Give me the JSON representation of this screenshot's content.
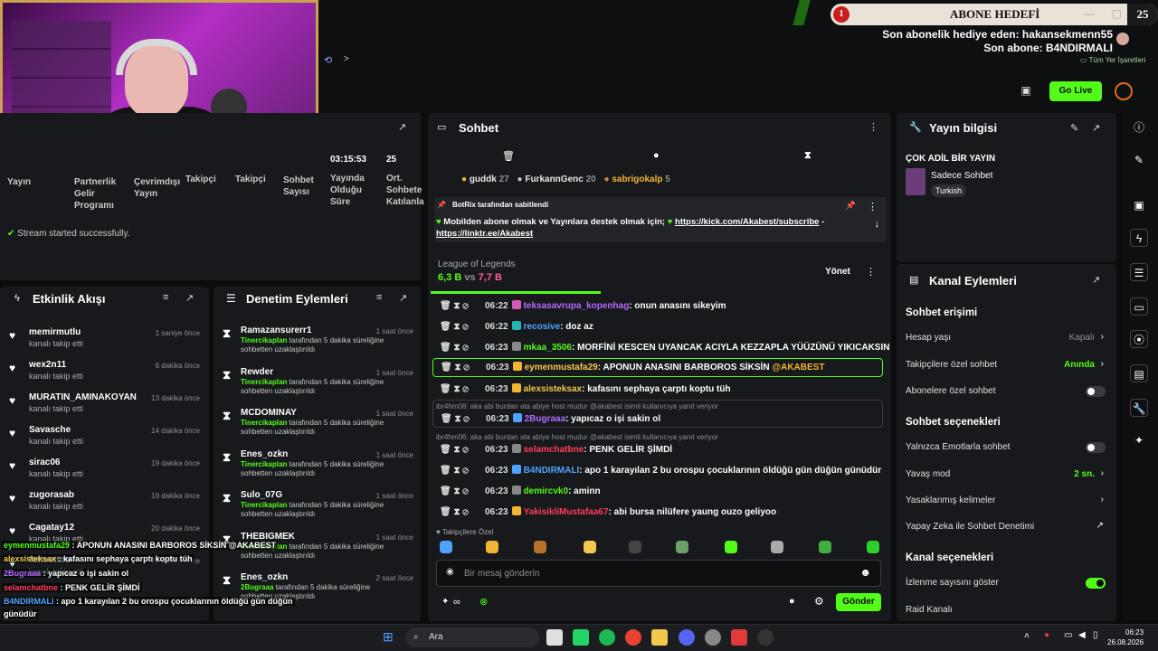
{
  "overlay": {
    "goal_count": "1",
    "goal_label": "ABONE HEDEFİ",
    "goal_target": "25",
    "last_gift_sub": "Son abonelik hediye eden: hakansekmenn55",
    "last_sub": "Son abone: B4NDIRMALI",
    "bookmarks": "Tüm Yer İşaretleri"
  },
  "header": {
    "go_live": "Go Live"
  },
  "stats": {
    "items": [
      {
        "label": "Yayın"
      },
      {
        "label": "Partnerlik Gelir Programı"
      },
      {
        "label": "Çevrimdışı Yayın"
      },
      {
        "label": "Takipçi"
      },
      {
        "label": "Takipçi"
      },
      {
        "label": "Sohbet Sayısı"
      },
      {
        "value": "03:15:53",
        "label": "Yayında Olduğu Süre"
      },
      {
        "value": "25",
        "label": "Ort. Sohbete Katılanla"
      }
    ],
    "status": "Stream started successfully."
  },
  "activity": {
    "title": "Etkinlik Akışı",
    "items": [
      {
        "name": "memirmutlu",
        "sub": "kanalı takip etti",
        "time": "1 saniye önce"
      },
      {
        "name": "wex2n11",
        "sub": "kanalı takip etti",
        "time": "6 dakika önce"
      },
      {
        "name": "MURATIN_AMINAKOYAN",
        "sub": "kanalı takip etti",
        "time": "13 dakika önce"
      },
      {
        "name": "Savasche",
        "sub": "kanalı takip etti",
        "time": "14 dakika önce"
      },
      {
        "name": "sirac06",
        "sub": "kanalı takip etti",
        "time": "19 dakika önce"
      },
      {
        "name": "zugorasab",
        "sub": "kanalı takip etti",
        "time": "19 dakika önce"
      },
      {
        "name": "Cagatay12",
        "sub": "kanalı takip etti",
        "time": "20 dakika önce"
      },
      {
        "name": "fettoettoo",
        "sub": "kanalı takip etti",
        "time": "28 dakika önce"
      }
    ]
  },
  "moderation": {
    "title": "Denetim Eylemleri",
    "desc_suffix": "tarafından 5 dakika süreliğine sohbetten uzaklaştırıldı",
    "items": [
      {
        "name": "Ramazansurerr1",
        "mod": "Tinercikaplan",
        "time": "1 saat önce"
      },
      {
        "name": "Rewder",
        "mod": "Tinercikaplan",
        "time": "1 saat önce"
      },
      {
        "name": "MCDOMINAY",
        "mod": "Tinercikaplan",
        "time": "1 saat önce"
      },
      {
        "name": "Enes_ozkn",
        "mod": "Tinercikaplan",
        "time": "1 saat önce"
      },
      {
        "name": "Sulo_07G",
        "mod": "Tinercikaplan",
        "time": "1 saat önce"
      },
      {
        "name": "THEBIGMEK",
        "mod": "Tinercikaplan",
        "time": "1 saat önce"
      },
      {
        "name": "Enes_ozkn",
        "mod": "2Bugraaa",
        "time": "2 saat önce"
      }
    ]
  },
  "overlay_chat": [
    {
      "user": "eymenmustafa29",
      "text": " : APONUN ANASINI BARBOROS SİKSİN @AKABEST",
      "color": "#53fc18"
    },
    {
      "user": "alexsisteksax",
      "text": " : kafasını sephaya çarptı koptu tüh",
      "color": "#f2c94c"
    },
    {
      "user": "2Bugraaa",
      "text": " : yapıcaz o işi sakin ol",
      "color": "#b26bff"
    },
    {
      "user": "selamchatbne",
      "text": " : PENK GELİR ŞİMDİ",
      "color": "#ff3b5c"
    },
    {
      "user": "B4NDIRMALI",
      "text": " : apo 1 karayılan 2 bu orospu çocuklarının öldüğü gün düğün",
      "color": "#4fa3ff"
    },
    {
      "user": "",
      "text": "günüdür",
      "color": "#fff"
    },
    {
      "user": "demircvk0",
      "text": " : aminn",
      "color": "#53fc18"
    },
    {
      "user": "YakisikliMustafaa67",
      "text": " : abi bursa nilüfere yaung ouzo geliyoo",
      "color": "#ff3b5c"
    }
  ],
  "chat": {
    "title": "Sohbet",
    "top_chatters": [
      {
        "name": "guddk",
        "count": "27"
      },
      {
        "name": "FurkannGenc",
        "count": "20"
      },
      {
        "name": "sabrigokalp",
        "count": "5"
      }
    ],
    "pinned_by": "BotRix tarafından sabitlendi",
    "pinned_text": "Mobilden abone olmak ve Yayınlara destek olmak için;",
    "pinned_link1": "https://kick.com/Akabest/subscribe",
    "pinned_link2": "https://linktr.ee/Akabest",
    "game": "League of Legends",
    "prediction_a": "6,3 B",
    "prediction_vs": "vs",
    "prediction_b": "7,7 B",
    "manage": "Yönet",
    "messages": [
      {
        "time": "06:22",
        "user": "teksasavrupa_kopenhag",
        "text": ": onun anasını sikeyim",
        "color": "#b26bff"
      },
      {
        "time": "06:22",
        "user": "recosive",
        "text": ": doz az",
        "color": "#4fa3ff"
      },
      {
        "time": "06:23",
        "user": "mkaa_3506",
        "text": ": MORFİNİ KESCEN UYANCAK ACIYLA KEZZAPLA YÜÜZÜNÜ YIKICAKSIN",
        "color": "#53fc18"
      },
      {
        "time": "06:23",
        "user": "eymenmustafa29",
        "text": ": APONUN ANASINI BARBOROS SİKSİN @AKABEST",
        "color": "#f2c94c",
        "mention": "@AKABEST"
      },
      {
        "time": "06:23",
        "user": "alexsisteksax",
        "text": ": kafasını sephaya çarptı koptu tüh",
        "color": "#f2c94c"
      },
      {
        "time": "06:23",
        "user": "2Bugraaa",
        "text": ": yapıcaz o işi sakin ol",
        "color": "#b26bff"
      },
      {
        "time": "06:23",
        "user": "selamchatbne",
        "text": ": PENK GELİR ŞİMDİ",
        "color": "#ff3b5c"
      },
      {
        "time": "06:23",
        "user": "B4NDIRMALI",
        "text": ": apo 1 karayılan 2 bu orospu çocuklarının öldüğü gün düğün günüdür",
        "color": "#4fa3ff"
      },
      {
        "time": "06:23",
        "user": "demircvk0",
        "text": ": aminn",
        "color": "#53fc18"
      },
      {
        "time": "06:23",
        "user": "YakisikliMustafaa67",
        "text": ": abi bursa nilüfere yaung ouzo geliyoo",
        "color": "#ff3b5c"
      }
    ],
    "reply_1": "ibr4hm06: aka abi burdan ata abiye host mudur @akabest isimli kullanıcıya yanıt veriyor",
    "reply_2": "ibr4hm06: aka abi burdan ata abiye host mudur @akabest isimli kullanıcıya yanıt veriyor",
    "followers_only": "Takipçilere Özel",
    "input_placeholder": "Bir mesaj gönderin",
    "send": "Gönder"
  },
  "stream_info": {
    "title": "Yayın bilgisi",
    "stream_title": "ÇOK ADİL BİR YAYIN",
    "category": "Sadece Sohbet",
    "tag": "Turkish"
  },
  "channel_actions": {
    "title": "Kanal Eylemleri",
    "chat_access": "Sohbet erişimi",
    "account_age": "Hesap yaşı",
    "account_age_val": "Kapalı",
    "followers_only": "Takipçilere özel sohbet",
    "followers_only_val": "Anında",
    "subs_only": "Abonelere özel sohbet",
    "chat_options": "Sohbet seçenekleri",
    "emote_only": "Yalnızca Emotlarla sohbet",
    "slow_mode": "Yavaş mod",
    "slow_mode_val": "2 sn.",
    "banned_words": "Yasaklanmış kelimeler",
    "ai_moderation": "Yapay Zeka ile Sohbet Denetimi",
    "channel_options": "Kanal seçenekleri",
    "show_viewers": "İzlenme sayısını göster",
    "raid": "Raid Kanalı"
  },
  "taskbar": {
    "search": "Ara",
    "time": "06:23",
    "date": "26.08.2026"
  },
  "colors": {
    "accent": "#53fc18",
    "panel": "#18191c",
    "bg": "#0b0c0e"
  }
}
